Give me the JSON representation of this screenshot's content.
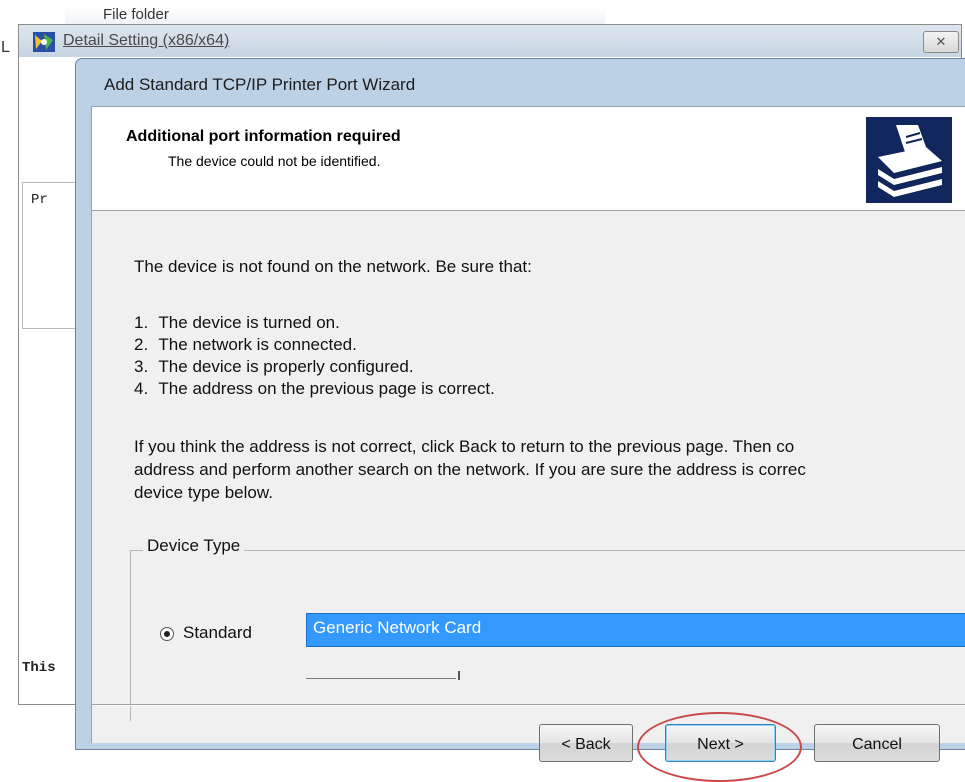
{
  "background_window": {
    "top_strip_text": "File folder",
    "title_edge_char": "L",
    "title": "Detail Setting (x86/x64)",
    "close_glyph": "✕",
    "group_label": "Pr",
    "footer_text": "This"
  },
  "wizard": {
    "title": "Add Standard TCP/IP Printer Port Wizard",
    "header": {
      "title": "Additional port information required",
      "subtitle": "The device could not be identified.",
      "icon": "printer-port-wizard-icon"
    },
    "intro": "The device is not found on the network.  Be sure that:",
    "checklist": [
      {
        "num": "1.",
        "text": "The device is turned on."
      },
      {
        "num": "2.",
        "text": "The network is connected."
      },
      {
        "num": "3.",
        "text": "The device is properly configured."
      },
      {
        "num": "4.",
        "text": "The address on the previous page is correct."
      }
    ],
    "paragraph_lines": [
      "If you think the address is not correct, click Back to return to the previous page.  Then co",
      "address and perform another search on the network.  If you are sure the address is correc",
      "device type below."
    ],
    "device_type": {
      "group_label": "Device Type",
      "radio_label": "Standard",
      "radio_selected": true,
      "selected_value": "Generic Network Card"
    },
    "buttons": {
      "back": "< Back",
      "next": "Next >",
      "cancel": "Cancel"
    },
    "highlight_color": "#c74b4b",
    "selection_color": "#3399ff"
  }
}
